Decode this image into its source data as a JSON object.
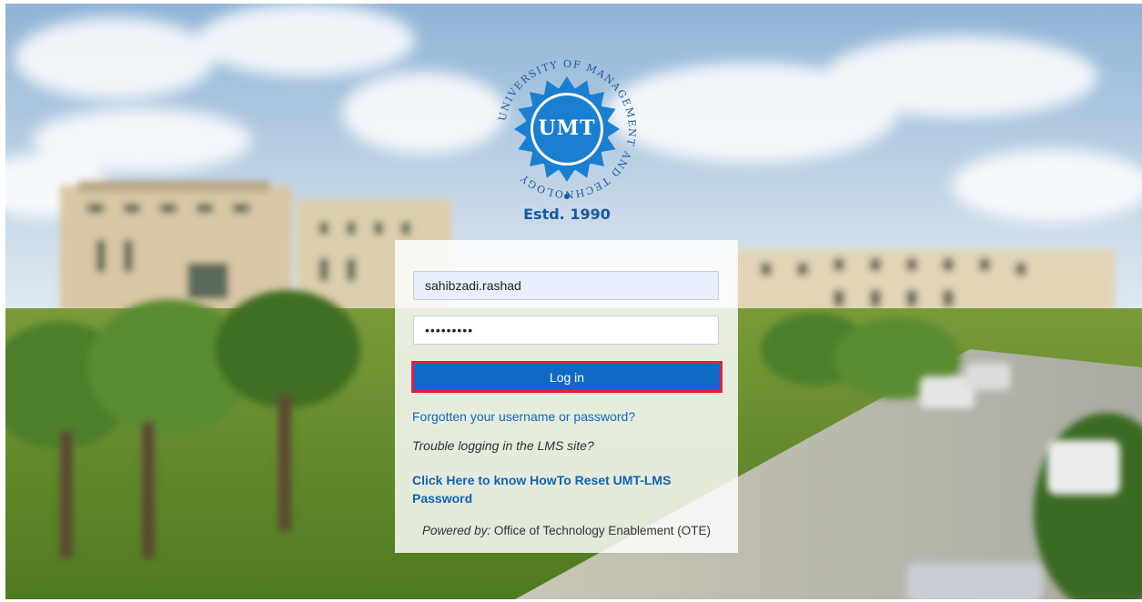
{
  "logo": {
    "top_text": "UNIVERSITY OF MANAGEMENT AND TECHNOLOGY",
    "center_text": "UMT",
    "estd": "Estd. 1990"
  },
  "login": {
    "username_value": "sahibzadi.rashad",
    "password_value": "•••••••••",
    "login_button": "Log in",
    "forgot_link": "Forgotten your username or password?",
    "trouble_text": "Trouble logging in the LMS site?",
    "reset_link": "Click Here to know HowTo Reset UMT-LMS Password",
    "powered_label": "Powered by:",
    "powered_org": "Office of Technology Enablement (OTE)"
  },
  "colors": {
    "brand_blue": "#1169c6",
    "button_border": "#e0213b",
    "link_blue": "#1167c1",
    "logo_blue": "#1b7fd1"
  },
  "icons": [
    "umt-logo-icon"
  ]
}
